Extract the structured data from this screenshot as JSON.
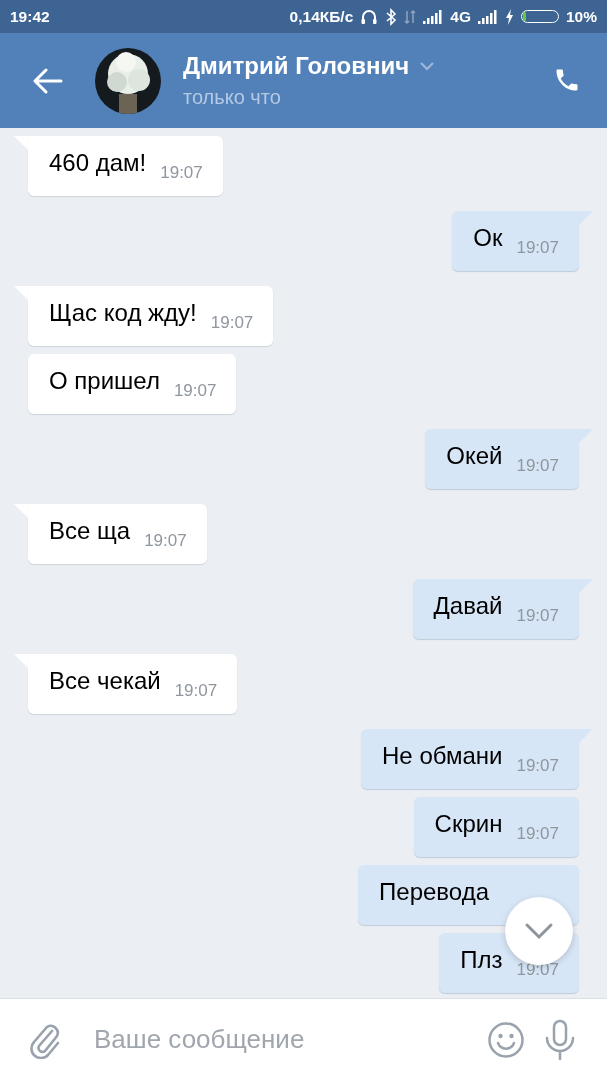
{
  "status_bar": {
    "time": "19:42",
    "speed": "0,14КБ/с",
    "network": "4G",
    "battery": {
      "level": 0.1
    },
    "battery_text": "10%"
  },
  "header": {
    "name": "Дмитрий Головнич",
    "status": "только что"
  },
  "messages": [
    {
      "kind": "incoming",
      "text": "460 дам!",
      "time": "19:07"
    },
    {
      "kind": "outgoing",
      "text": "Ок",
      "time": "19:07"
    },
    {
      "kind": "incoming",
      "text": "Щас код жду!",
      "time": "19:07"
    },
    {
      "kind": "incoming",
      "text": "О пришел",
      "time": "19:07"
    },
    {
      "kind": "outgoing",
      "text": "Окей",
      "time": "19:07"
    },
    {
      "kind": "incoming",
      "text": "Все ща",
      "time": "19:07"
    },
    {
      "kind": "outgoing",
      "text": "Давай",
      "time": "19:07"
    },
    {
      "kind": "incoming",
      "text": "Все чекай",
      "time": "19:07"
    },
    {
      "kind": "outgoing",
      "text": "Не обмани",
      "time": "19:07"
    },
    {
      "kind": "outgoing",
      "text": "Скрин",
      "time": "19:07"
    },
    {
      "kind": "outgoing",
      "text": "Перевода"
    },
    {
      "kind": "outgoing",
      "text": "Плз",
      "time": "19:07"
    }
  ],
  "composer": {
    "placeholder": "Ваше сообщение"
  }
}
